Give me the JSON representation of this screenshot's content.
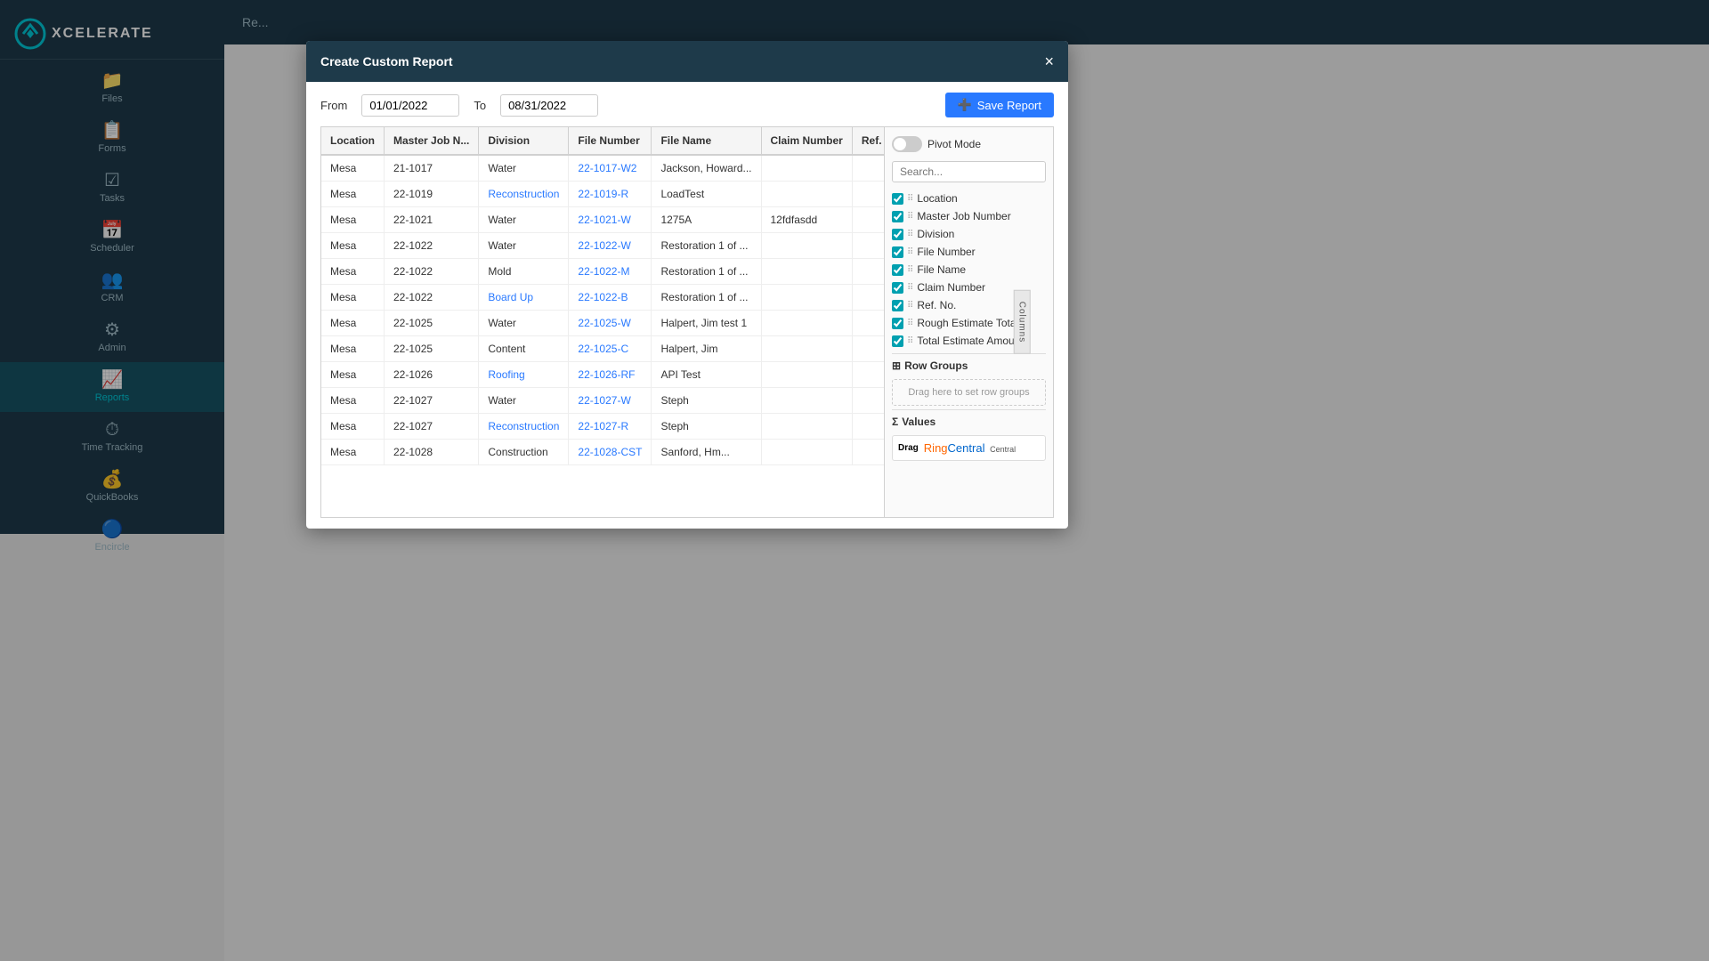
{
  "app": {
    "logo_text": "XCELERATE"
  },
  "sidebar": {
    "items": [
      {
        "id": "files",
        "label": "Files",
        "icon": "📁"
      },
      {
        "id": "forms",
        "label": "Forms",
        "icon": "📋"
      },
      {
        "id": "tasks",
        "label": "Tasks",
        "icon": "☑"
      },
      {
        "id": "scheduler",
        "label": "Scheduler",
        "icon": "📅"
      },
      {
        "id": "crm",
        "label": "CRM",
        "icon": "👥"
      },
      {
        "id": "admin",
        "label": "Admin",
        "icon": "⚙"
      },
      {
        "id": "reports",
        "label": "Reports",
        "icon": "📈",
        "active": true
      },
      {
        "id": "time-tracking",
        "label": "Time Tracking",
        "icon": "⏱"
      },
      {
        "id": "quickbooks",
        "label": "QuickBooks",
        "icon": "💰"
      },
      {
        "id": "encircle",
        "label": "Encircle",
        "icon": "🔵"
      }
    ]
  },
  "main_header": {
    "text": "Re..."
  },
  "dialog": {
    "title": "Create Custom Report",
    "close_label": "×",
    "from_label": "From",
    "to_label": "To",
    "from_date": "01/01/2022",
    "to_date": "08/31/2022",
    "save_button_label": "Save Report",
    "columns_tab": "Columns",
    "pivot_label": "Pivot Mode",
    "search_placeholder": "Search...",
    "table": {
      "headers": [
        "Location",
        "Master Job N...",
        "Division",
        "File Number",
        "File Name",
        "Claim Number",
        "Ref. No"
      ],
      "rows": [
        {
          "location": "Mesa",
          "master_job": "21-1017",
          "division": "Water",
          "file_number": "22-1017-W2",
          "file_name": "Jackson, Howard...",
          "claim_number": "",
          "ref_no": ""
        },
        {
          "location": "Mesa",
          "master_job": "22-1019",
          "division": "Reconstruction",
          "file_number": "22-1019-R",
          "file_name": "LoadTest",
          "claim_number": "",
          "ref_no": ""
        },
        {
          "location": "Mesa",
          "master_job": "22-1021",
          "division": "Water",
          "file_number": "22-1021-W",
          "file_name": "1275A",
          "claim_number": "12fdfasdd",
          "ref_no": ""
        },
        {
          "location": "Mesa",
          "master_job": "22-1022",
          "division": "Water",
          "file_number": "22-1022-W",
          "file_name": "Restoration 1 of ...",
          "claim_number": "",
          "ref_no": ""
        },
        {
          "location": "Mesa",
          "master_job": "22-1022",
          "division": "Mold",
          "file_number": "22-1022-M",
          "file_name": "Restoration 1 of ...",
          "claim_number": "",
          "ref_no": ""
        },
        {
          "location": "Mesa",
          "master_job": "22-1022",
          "division": "Board Up",
          "file_number": "22-1022-B",
          "file_name": "Restoration 1 of ...",
          "claim_number": "",
          "ref_no": ""
        },
        {
          "location": "Mesa",
          "master_job": "22-1025",
          "division": "Water",
          "file_number": "22-1025-W",
          "file_name": "Halpert, Jim test 1",
          "claim_number": "",
          "ref_no": ""
        },
        {
          "location": "Mesa",
          "master_job": "22-1025",
          "division": "Content",
          "file_number": "22-1025-C",
          "file_name": "Halpert, Jim",
          "claim_number": "",
          "ref_no": ""
        },
        {
          "location": "Mesa",
          "master_job": "22-1026",
          "division": "Roofing",
          "file_number": "22-1026-RF",
          "file_name": "API Test",
          "claim_number": "",
          "ref_no": ""
        },
        {
          "location": "Mesa",
          "master_job": "22-1027",
          "division": "Water",
          "file_number": "22-1027-W",
          "file_name": "Steph",
          "claim_number": "",
          "ref_no": ""
        },
        {
          "location": "Mesa",
          "master_job": "22-1027",
          "division": "Reconstruction",
          "file_number": "22-1027-R",
          "file_name": "Steph",
          "claim_number": "",
          "ref_no": ""
        },
        {
          "location": "Mesa",
          "master_job": "22-1028",
          "division": "Construction",
          "file_number": "22-1028-CST",
          "file_name": "Sanford, Hm...",
          "claim_number": "",
          "ref_no": ""
        }
      ]
    },
    "columns": [
      {
        "name": "Location",
        "checked": true
      },
      {
        "name": "Master Job Number",
        "checked": true
      },
      {
        "name": "Division",
        "checked": true
      },
      {
        "name": "File Number",
        "checked": true
      },
      {
        "name": "File Name",
        "checked": true
      },
      {
        "name": "Claim Number",
        "checked": true
      },
      {
        "name": "Ref. No.",
        "checked": true
      },
      {
        "name": "Rough Estimate Total",
        "checked": true
      },
      {
        "name": "Total Estimate Amount",
        "checked": true
      }
    ],
    "row_groups_label": "Row Groups",
    "row_groups_placeholder": "Drag here to set row groups",
    "values_label": "Values",
    "values_placeholder": "Drag",
    "ring_central_text_orange": "Ring",
    "ring_central_text_blue": "Central"
  }
}
